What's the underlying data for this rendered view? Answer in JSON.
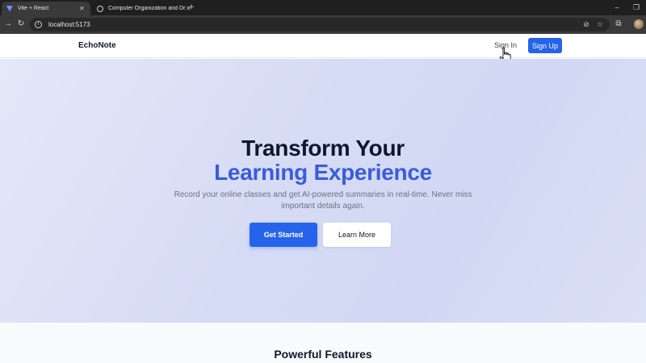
{
  "browser": {
    "tabs": [
      {
        "title": "Vite + React",
        "active": true
      },
      {
        "title": "Computer Organization and Design",
        "active": false
      }
    ],
    "url": "localhost:5173"
  },
  "nav": {
    "brand": "EchoNote",
    "signin_label": "Sign In",
    "signup_label": "Sign Up"
  },
  "hero": {
    "title_line1": "Transform Your",
    "title_line2": "Learning Experience",
    "subtitle": "Record your online classes and get AI-powered summaries in real-time. Never miss important details again.",
    "primary_cta": "Get Started",
    "secondary_cta": "Learn More"
  },
  "features": {
    "title": "Powerful Features"
  },
  "colors": {
    "accent": "#2563eb",
    "title_accent": "#3b5bdb",
    "heading": "#0f172a"
  },
  "icons": [
    "vite-favicon",
    "globe-favicon",
    "forward-arrow-icon",
    "reload-icon",
    "site-info-icon",
    "eye-off-icon",
    "star-icon",
    "extensions-icon",
    "avatar",
    "pointer-cursor-icon"
  ]
}
